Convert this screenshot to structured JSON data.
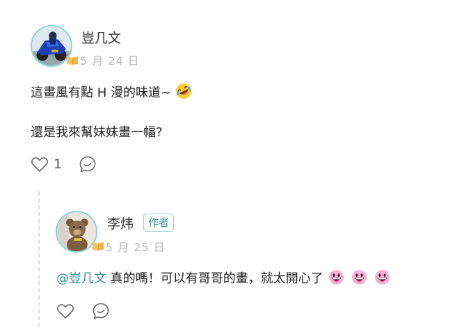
{
  "comment": {
    "author": "豈几文",
    "date": "5 月 24 日",
    "line1": "這畫風有點 H 漫的味道~",
    "line2": "還是我來幫妹妹畫一幅?",
    "like_count": "1"
  },
  "reply": {
    "author": "李炜",
    "author_badge": "作者",
    "date": "5 月 25 日",
    "mention": "@豈几文",
    "text": " 真的嗎！可以有哥哥的畫，就太開心了"
  },
  "colors": {
    "avatar_ring": "#8ad4d4",
    "mention": "#2d8fa0",
    "badge_text": "#3a8f8a",
    "date": "#b8b8b8"
  },
  "icons": [
    "book-icon",
    "rofl-emoji",
    "heart-icon",
    "comment-icon",
    "grin-emoji"
  ]
}
